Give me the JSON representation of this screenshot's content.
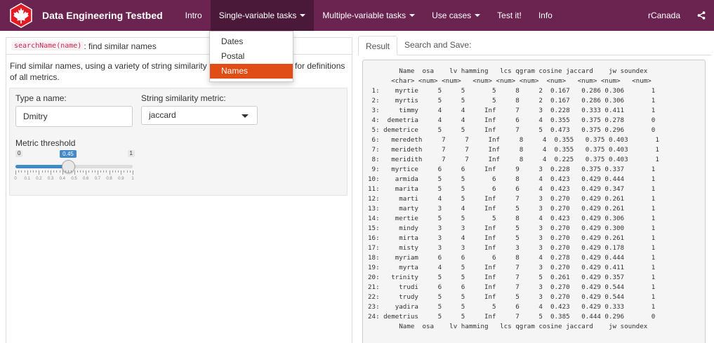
{
  "navbar": {
    "brand_title": "Data Engineering Testbed",
    "items": [
      {
        "label": "Intro",
        "caret": false
      },
      {
        "label": "Single-variable tasks",
        "caret": true,
        "active": true
      },
      {
        "label": "Multiple-variable tasks",
        "caret": true
      },
      {
        "label": "Use cases",
        "caret": true
      },
      {
        "label": "Test it!",
        "caret": false
      },
      {
        "label": "Info",
        "caret": false
      }
    ],
    "right_label": "rCanada",
    "share_icon": "share-icon",
    "logo_icon": "maple-leaf-icon"
  },
  "dropdown": {
    "items": [
      {
        "label": "Dates",
        "active": false
      },
      {
        "label": "Postal",
        "active": false
      },
      {
        "label": "Names",
        "active": true
      }
    ]
  },
  "left_panel": {
    "header_code": "searchName(name)",
    "header_text": ": find similar names",
    "description_line1": "Find similar names, using a variety of string similarity me",
    "description_line1_end": "for definitions",
    "description_line2": "of all metrics.",
    "name_label": "Type a name:",
    "name_value": "Dmitry",
    "metric_label": "String similarity metric:",
    "metric_value": "jaccard",
    "threshold_label": "Metric threshold",
    "slider": {
      "min": 0,
      "max": 1,
      "value": 0.45,
      "min_label": "0",
      "max_label": "1",
      "value_label": "0.45",
      "grid_labels": [
        "0",
        "0.1",
        "0.2",
        "0.3",
        "0.4",
        "0.5",
        "0.6",
        "0.7",
        "0.8",
        "0.9",
        "1"
      ]
    }
  },
  "right_panel": {
    "tabs": [
      {
        "label": "Result",
        "active": true
      },
      {
        "label": "Search and Save:",
        "active": false
      }
    ],
    "output_lines": [
      "        Name  osa    lv hamming   lcs qgram cosine jaccard    jw soundex",
      "      <char> <num> <num>   <num> <num> <num>  <num>   <num> <num>   <num>",
      " 1:    myrtie     5     5       5     8     2  0.167   0.286 0.306       1",
      " 2:    myrtis     5     5       5     8     2  0.167   0.286 0.306       1",
      " 3:     timmy     4     4     Inf     7     3  0.228   0.333 0.411       1",
      " 4:  demetria     4     4     Inf     6     4  0.355   0.375 0.278       0",
      " 5: demetrice     5     5     Inf     7     5  0.473   0.375 0.296       0",
      " 6:   meredeth     7     7     Inf     8     4  0.355   0.375 0.403       1",
      " 7:   merideth     7     7     Inf     8     4  0.355   0.375 0.403       1",
      " 8:   meridith     7     7     Inf     8     4  0.225   0.375 0.403       1",
      " 9:   myrtice     6     6     Inf     9     3  0.228   0.375 0.337       1",
      "10:    armida     5     5       6     8     4  0.423   0.429 0.444       1",
      "11:    marita     5     5       6     6     4  0.423   0.429 0.347       1",
      "12:     marti     4     5     Inf     7     3  0.270   0.429 0.261       1",
      "13:     marty     3     4     Inf     5     3  0.270   0.429 0.261       1",
      "14:    mertie     5     5       5     8     4  0.423   0.429 0.306       1",
      "15:     mindy     3     3     Inf     5     3  0.270   0.429 0.300       1",
      "16:     mirta     3     4     Inf     5     3  0.270   0.429 0.261       1",
      "17:     misty     3     3     Inf     3     3  0.270   0.429 0.178       1",
      "18:    myriam     6     6       6     8     4  0.278   0.429 0.444       1",
      "19:     myrta     4     5     Inf     7     3  0.270   0.429 0.411       1",
      "20:   trinity     5     5     Inf     7     5  0.261   0.429 0.357       1",
      "21:     trudi     6     6     Inf     7     3  0.270   0.429 0.544       1",
      "22:     trudy     5     5     Inf     5     3  0.270   0.429 0.544       1",
      "23:    yadira     5     5       5     6     4  0.423   0.429 0.333       1",
      "24: demetrius     5     5     Inf     7     5  0.385   0.444 0.296       0",
      "        Name  osa    lv hamming   lcs qgram cosine jaccard    jw soundex"
    ]
  },
  "colors": {
    "navbar_bg": "#6b2350",
    "navbar_active": "#4a1838",
    "dropdown_active": "#e04d16",
    "slider_accent": "#428bca",
    "logo_red": "#e31b23"
  }
}
